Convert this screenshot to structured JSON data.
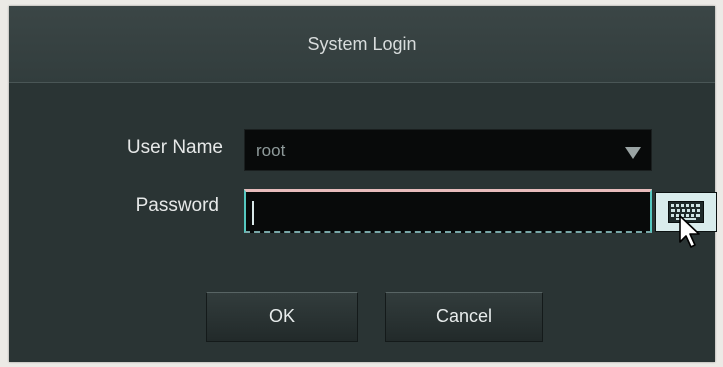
{
  "dialog": {
    "title": "System Login"
  },
  "form": {
    "username_label": "User Name",
    "username_value": "root",
    "password_label": "Password",
    "password_value": ""
  },
  "buttons": {
    "ok_label": "OK",
    "cancel_label": "Cancel"
  },
  "icons": {
    "dropdown": "chevron-down-icon",
    "keyboard": "keyboard-icon",
    "pointer": "mouse-pointer-icon"
  },
  "colors": {
    "dialog_bg": "#2c3636",
    "field_bg": "#080a0a",
    "focus_accent": "#55c8c0",
    "keyboard_button_bg": "#d9ecec"
  }
}
